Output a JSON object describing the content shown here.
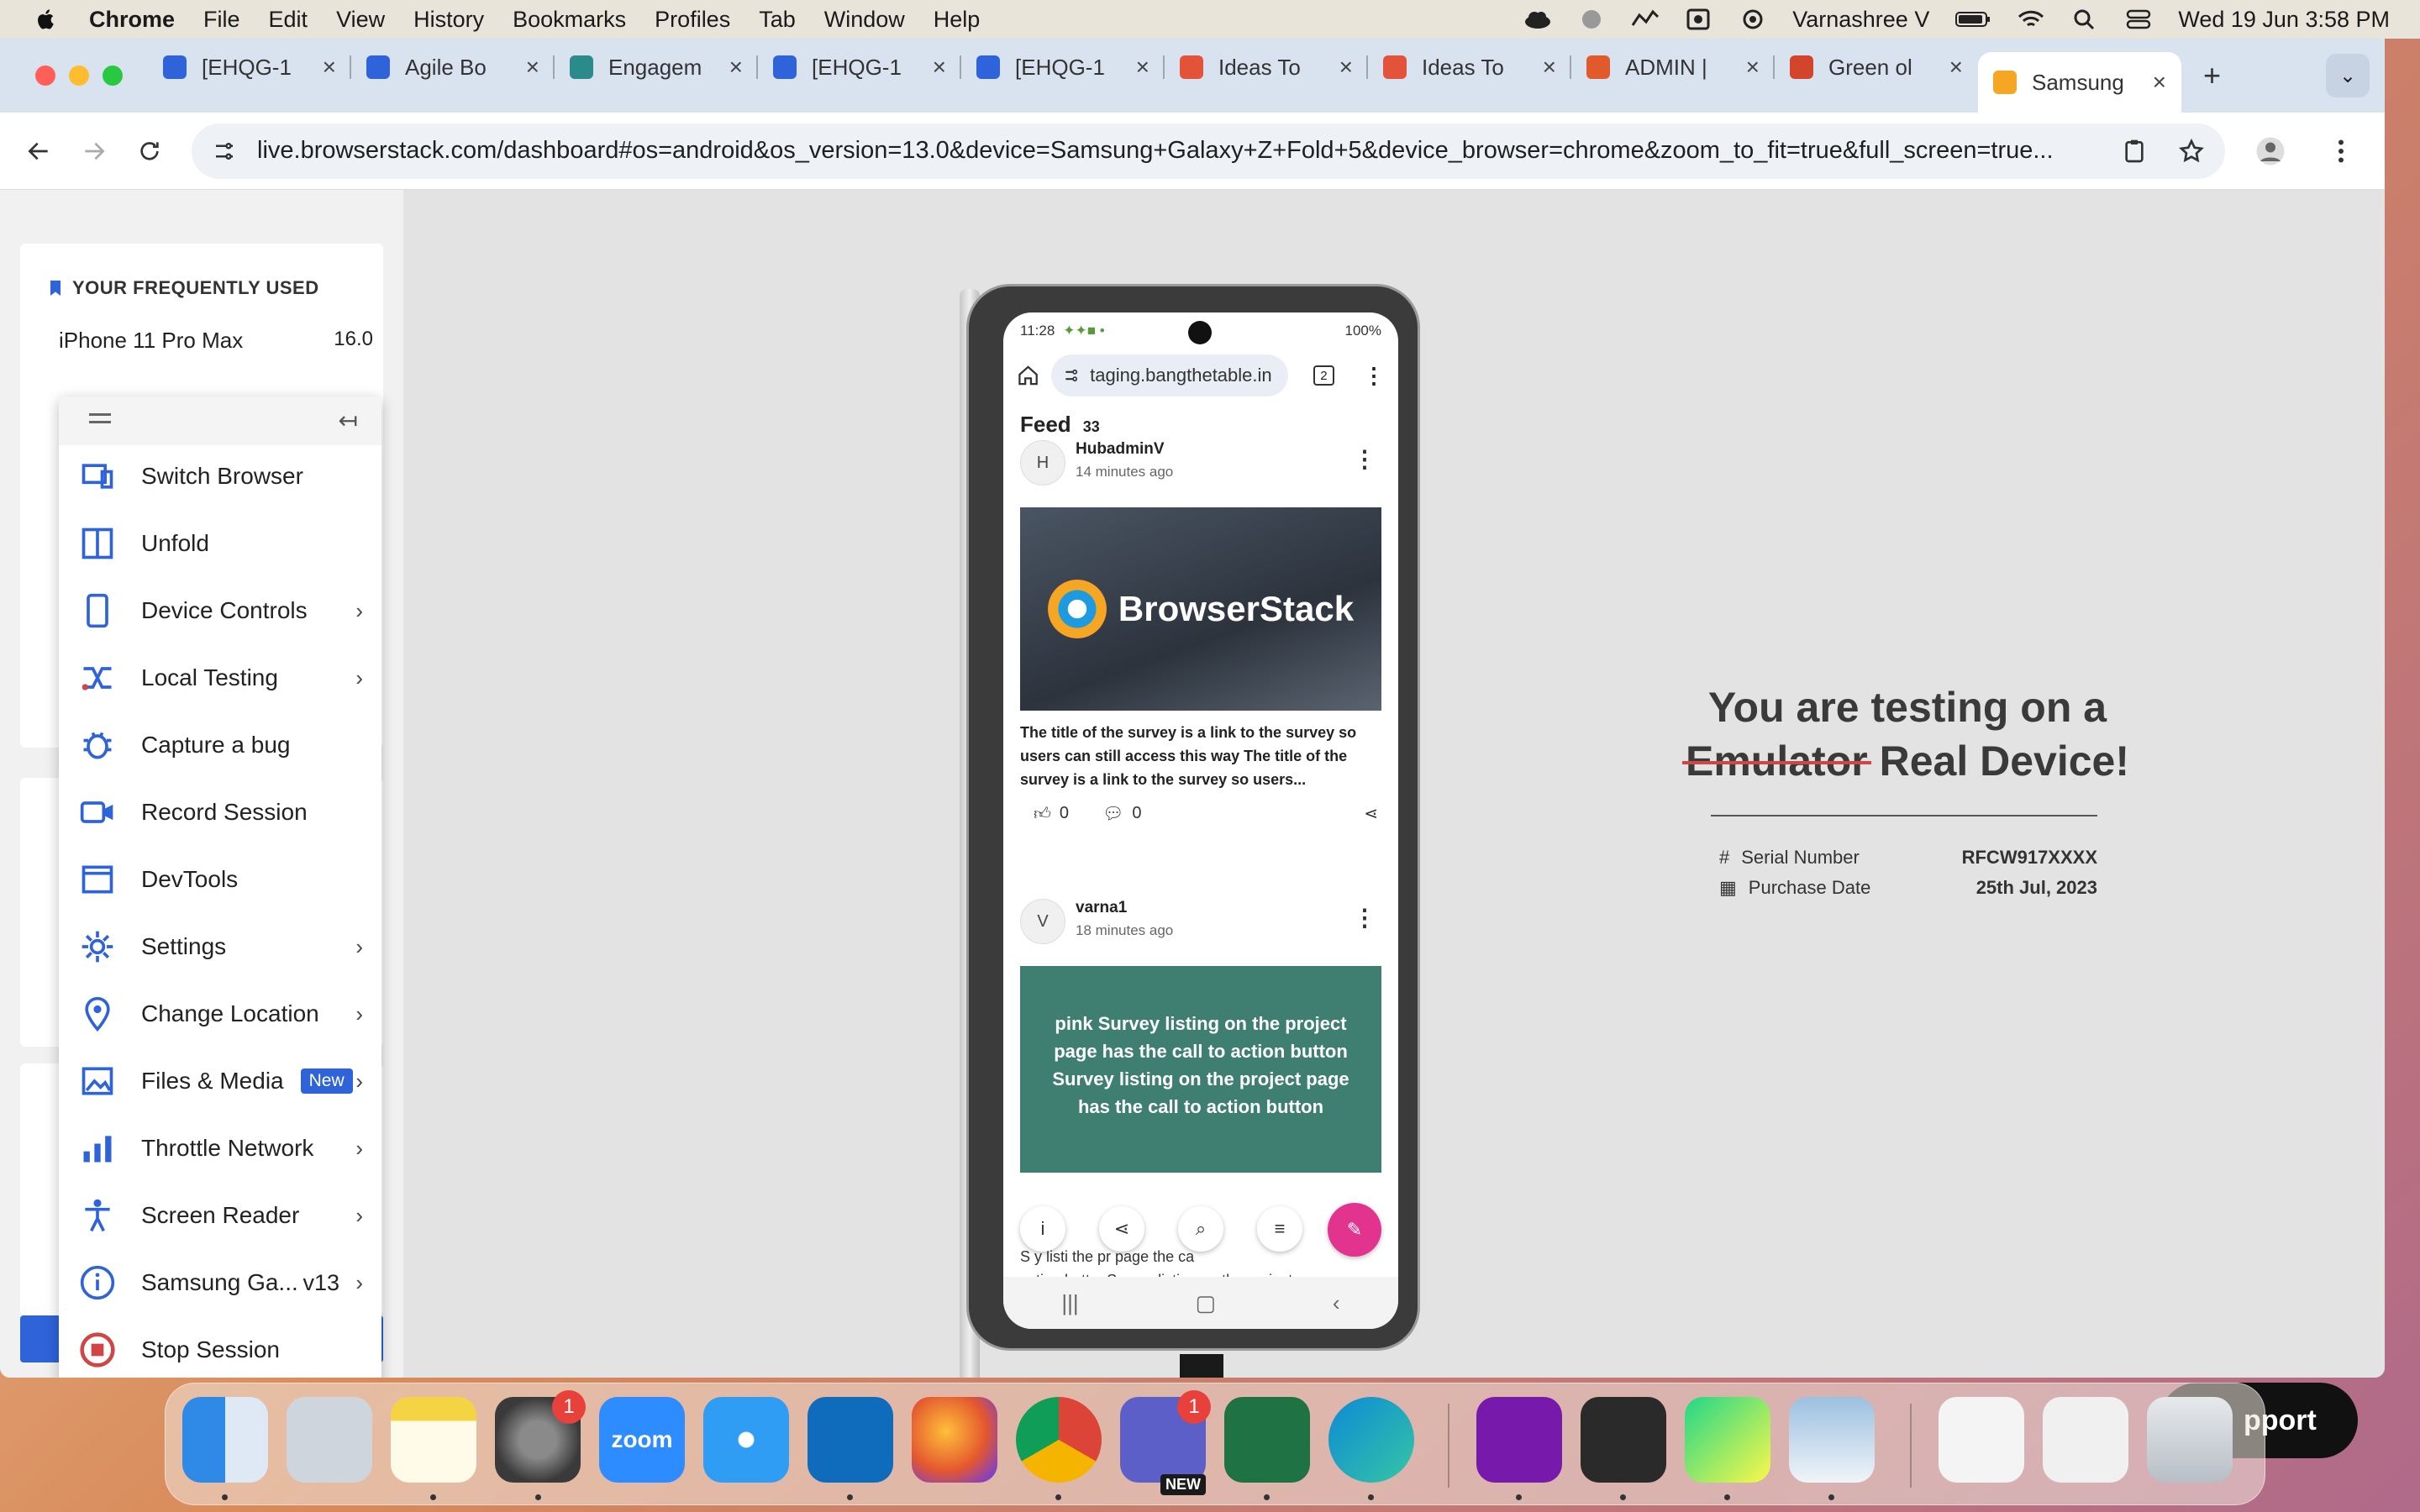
{
  "menubar": {
    "app": "Chrome",
    "items": [
      "File",
      "Edit",
      "View",
      "History",
      "Bookmarks",
      "Profiles",
      "Tab",
      "Window",
      "Help"
    ],
    "user": "Varnashree V",
    "datetime": "Wed 19 Jun  3:58 PM"
  },
  "tabs": [
    {
      "label": "[EHQG-1",
      "icon": "jira-icon",
      "color": "#2f63d9"
    },
    {
      "label": "Agile Bo",
      "icon": "jira-icon",
      "color": "#2f63d9"
    },
    {
      "label": "Engagem",
      "icon": "sharepoint-icon",
      "color": "#2b8a8a"
    },
    {
      "label": "[EHQG-1",
      "icon": "jira-icon",
      "color": "#2f63d9"
    },
    {
      "label": "[EHQG-1",
      "icon": "jira-icon",
      "color": "#2f63d9"
    },
    {
      "label": "Ideas To",
      "icon": "figma-icon",
      "color": "#e2533a"
    },
    {
      "label": "Ideas To",
      "icon": "figma-icon",
      "color": "#e2533a"
    },
    {
      "label": "ADMIN |",
      "icon": "admin-icon",
      "color": "#e05a2b"
    },
    {
      "label": "Green ol",
      "icon": "app-icon",
      "color": "#d2452b"
    },
    {
      "label": "Samsung",
      "icon": "browserstack-icon",
      "color": "#f5a623"
    }
  ],
  "toolbar": {
    "url": "live.browserstack.com/dashboard#os=android&os_version=13.0&device=Samsung+Galaxy+Z+Fold+5&device_browser=chrome&zoom_to_fit=true&full_screen=true..."
  },
  "frequent": {
    "title": "YOUR FREQUENTLY USED",
    "first_device": "iPhone 11 Pro Max",
    "first_version": "16.0"
  },
  "menu": {
    "items": [
      {
        "label": "Switch Browser",
        "icon": "switch-browser-icon",
        "chevron": false
      },
      {
        "label": "Unfold",
        "icon": "unfold-icon",
        "chevron": false
      },
      {
        "label": "Device Controls",
        "icon": "device-icon",
        "chevron": true
      },
      {
        "label": "Local Testing",
        "icon": "local-testing-icon",
        "chevron": true
      },
      {
        "label": "Capture a bug",
        "icon": "bug-icon",
        "chevron": false
      },
      {
        "label": "Record Session",
        "icon": "video-icon",
        "chevron": false
      },
      {
        "label": "DevTools",
        "icon": "devtools-icon",
        "chevron": false
      },
      {
        "label": "Settings",
        "icon": "gear-icon",
        "chevron": true
      },
      {
        "label": "Change Location",
        "icon": "location-icon",
        "chevron": true
      },
      {
        "label": "Files & Media",
        "icon": "image-icon",
        "chevron": true,
        "badge": "New"
      },
      {
        "label": "Throttle Network",
        "icon": "signal-icon",
        "chevron": true
      },
      {
        "label": "Screen Reader",
        "icon": "accessibility-icon",
        "chevron": true
      },
      {
        "label": "Samsung Ga...",
        "icon": "info-icon",
        "chevron": true,
        "version": "v13"
      },
      {
        "label": "Stop Session",
        "icon": "stop-icon",
        "chevron": false
      }
    ]
  },
  "phone": {
    "time": "11:28",
    "battery": "100%",
    "address": "taging.bangthetable.in",
    "tab_count": "2",
    "feed_title": "Feed",
    "feed_count": "33",
    "posts": [
      {
        "initial": "H",
        "user": "HubadminV",
        "time": "14 minutes ago",
        "image_text": "BrowserStack",
        "text": "The title of the survey is a link to the survey so users can still access this way The title of the survey is a link to the survey so users...",
        "likes": "0",
        "comments": "0"
      },
      {
        "initial": "V",
        "user": "varna1",
        "time": "18 minutes ago",
        "card_text": "pink Survey listing on the project page has the call to action button Survey listing on the project page has the call to action button"
      }
    ],
    "behind_text_1": "S    y listi      the pr     page     the ca",
    "behind_text_2": "action buttonSurvey listing on the project page"
  },
  "info": {
    "line1": "You are testing on a",
    "struck": "Emulator",
    "line2_rest": " Real Device!",
    "serial_label": "Serial Number",
    "serial_value": "RFCW917XXXX",
    "purchase_label": "Purchase Date",
    "purchase_value": "25th Jul, 2023"
  },
  "dock": {
    "settings_badge": "1",
    "teams_badge": "1",
    "teams_new": "NEW",
    "support_label": "pport"
  }
}
